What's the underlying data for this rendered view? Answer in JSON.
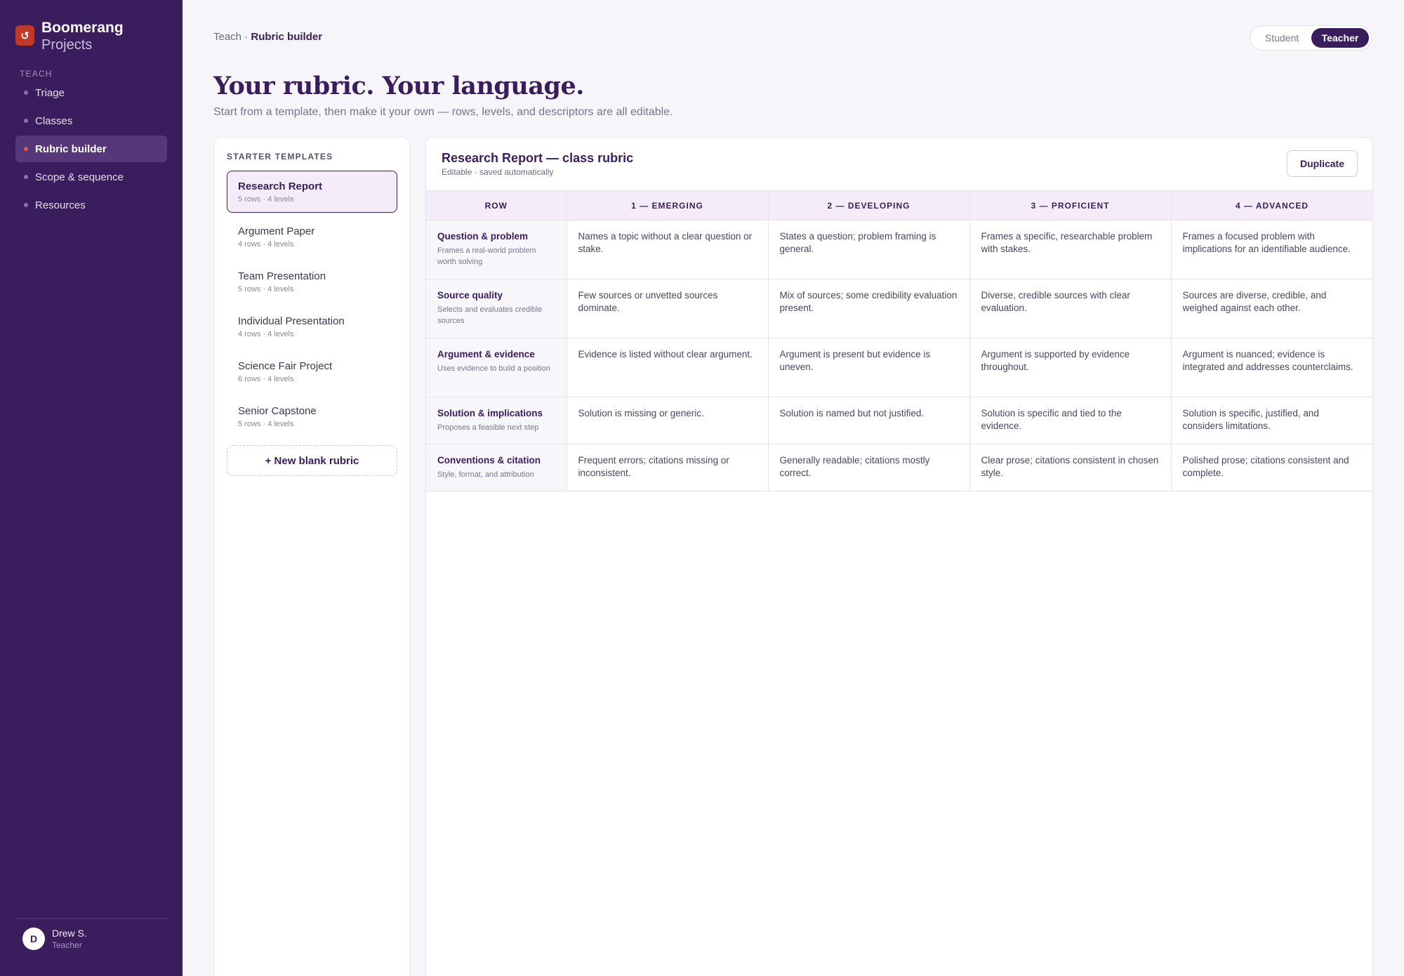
{
  "brand": {
    "name": "Boomerang",
    "sub": "Projects",
    "logo_glyph": "↺",
    "logo_color": "#c0392b"
  },
  "sidebar": {
    "section": "TEACH",
    "items": [
      {
        "label": "Triage"
      },
      {
        "label": "Classes"
      },
      {
        "label": "Rubric builder",
        "active": true
      },
      {
        "label": "Scope & sequence"
      },
      {
        "label": "Resources"
      }
    ],
    "user": {
      "initial": "D",
      "name": "Drew S.",
      "role": "Teacher"
    }
  },
  "header": {
    "breadcrumb_root": "Teach",
    "breadcrumb_sep": " · ",
    "breadcrumb_current": "Rubric builder",
    "mode": {
      "student": "Student",
      "teacher": "Teacher",
      "selected": "Teacher"
    }
  },
  "page": {
    "title": "Your rubric. Your language.",
    "subtitle": "Start from a template, then make it your own — rows, levels, and descriptors are all editable."
  },
  "templates": {
    "heading": "STARTER TEMPLATES",
    "items": [
      {
        "name": "Research Report",
        "meta": "5 rows · 4 levels",
        "active": true
      },
      {
        "name": "Argument Paper",
        "meta": "4 rows · 4 levels"
      },
      {
        "name": "Team Presentation",
        "meta": "5 rows · 4 levels"
      },
      {
        "name": "Individual Presentation",
        "meta": "4 rows · 4 levels"
      },
      {
        "name": "Science Fair Project",
        "meta": "6 rows · 4 levels"
      },
      {
        "name": "Senior Capstone",
        "meta": "5 rows · 4 levels"
      }
    ],
    "new_blank": "+ New blank rubric"
  },
  "rubric": {
    "title": "Research Report — class rubric",
    "subtitle": "Editable · saved automatically",
    "duplicate_label": "Duplicate",
    "columns": [
      "ROW",
      "1 — EMERGING",
      "2 — DEVELOPING",
      "3 — PROFICIENT",
      "4 — ADVANCED"
    ],
    "rows": [
      {
        "title": "Question & problem",
        "desc": "Frames a real-world problem worth solving",
        "cells": [
          "Names a topic without a clear question or stake.",
          "States a question; problem framing is general.",
          "Frames a specific, researchable problem with stakes.",
          "Frames a focused problem with implications for an identifiable audience."
        ]
      },
      {
        "title": "Source quality",
        "desc": "Selects and evaluates credible sources",
        "cells": [
          "Few sources or unvetted sources dominate.",
          "Mix of sources; some credibility evaluation present.",
          "Diverse, credible sources with clear evaluation.",
          "Sources are diverse, credible, and weighed against each other."
        ]
      },
      {
        "title": "Argument & evidence",
        "desc": "Uses evidence to build a position",
        "cells": [
          "Evidence is listed without clear argument.",
          "Argument is present but evidence is uneven.",
          "Argument is supported by evidence throughout.",
          "Argument is nuanced; evidence is integrated and addresses counterclaims."
        ]
      },
      {
        "title": "Solution & implications",
        "desc": "Proposes a feasible next step",
        "cells": [
          "Solution is missing or generic.",
          "Solution is named but not justified.",
          "Solution is specific and tied to the evidence.",
          "Solution is specific, justified, and considers limitations."
        ]
      },
      {
        "title": "Conventions & citation",
        "desc": "Style, format, and attribution",
        "cells": [
          "Frequent errors; citations missing or inconsistent.",
          "Generally readable; citations mostly correct.",
          "Clear prose; citations consistent in chosen style.",
          "Polished prose; citations consistent and complete."
        ]
      }
    ]
  },
  "colors": {
    "sidebar_bg": "#3a1d5c",
    "accent": "#3a1d5c",
    "active_dot": "#e0594a",
    "header_tint": "#f4ecf8"
  }
}
